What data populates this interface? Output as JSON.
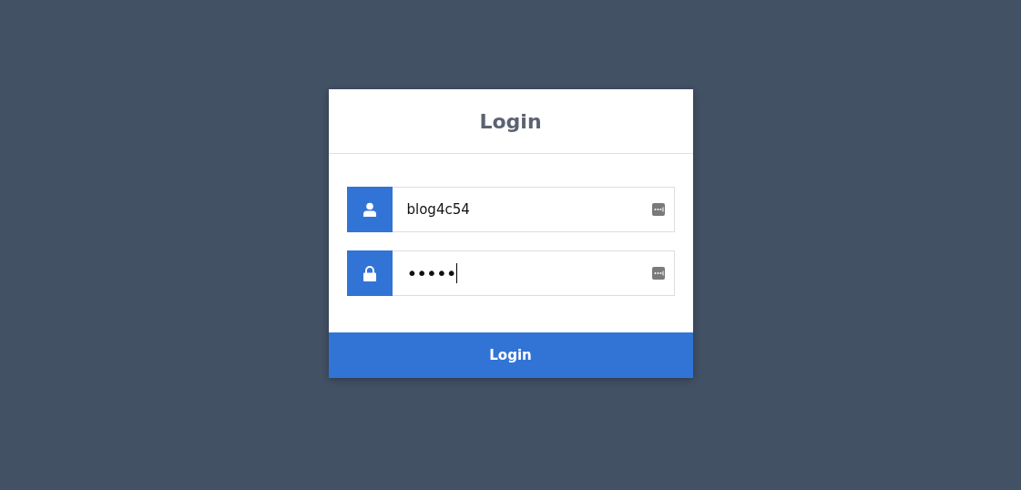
{
  "title": "Login",
  "fields": [
    {
      "kind": "user",
      "value": "blog4c54",
      "focused": false
    },
    {
      "kind": "password",
      "value": "•••••",
      "focused": true
    }
  ],
  "button": "Login"
}
